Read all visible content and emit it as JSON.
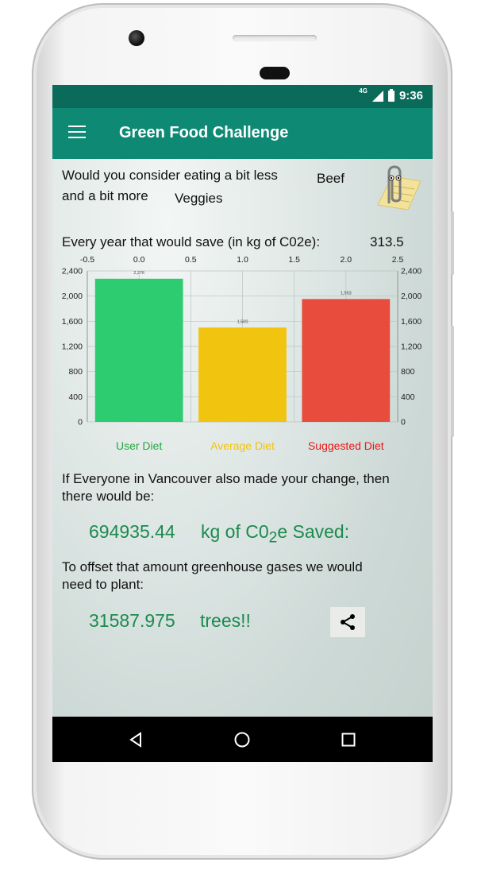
{
  "status": {
    "network": "4G",
    "time": "9:36"
  },
  "appbar": {
    "title": "Green Food Challenge"
  },
  "prompt": {
    "line1": "Would you consider eating a bit less",
    "food_less": "Beef",
    "line2": "and a bit more",
    "food_more": "Veggies"
  },
  "savings": {
    "label": "Every year that would save (in kg of C02e):",
    "value": "313.5"
  },
  "chart_data": {
    "type": "bar",
    "categories": [
      "User Diet",
      "Average Diet",
      "Suggested Diet"
    ],
    "values": [
      2276,
      1500,
      1953
    ],
    "value_labels": [
      "2,276",
      "1,500",
      "1,953"
    ],
    "colors": [
      "#2ecc71",
      "#f1c40f",
      "#e74c3c"
    ],
    "category_label_colors": [
      "#27a844",
      "#f1c40f",
      "#e81818"
    ],
    "ylim": [
      0,
      2400
    ],
    "y_ticks": [
      "0",
      "400",
      "800",
      "1,200",
      "1,600",
      "2,000",
      "2,400"
    ],
    "x_ticks": [
      "-0.5",
      "0.0",
      "0.5",
      "1.0",
      "1.5",
      "2.0",
      "2.5"
    ],
    "grid": true,
    "legend": "none"
  },
  "city": {
    "line1": "If Everyone in Vancouver also made your change, then",
    "line2": "there would be:",
    "amount": "694935.44",
    "unit_prefix": "kg of C0",
    "unit_sub": "2",
    "unit_suffix": "e Saved:"
  },
  "offset": {
    "line1": "To offset that amount greenhouse gases we would",
    "line2": "need to plant:",
    "trees": "31587.975",
    "trees_label": "trees!!"
  },
  "icons": {
    "menu": "menu-icon",
    "share": "share-icon",
    "back": "back-icon",
    "home": "home-icon",
    "recents": "recents-icon"
  }
}
